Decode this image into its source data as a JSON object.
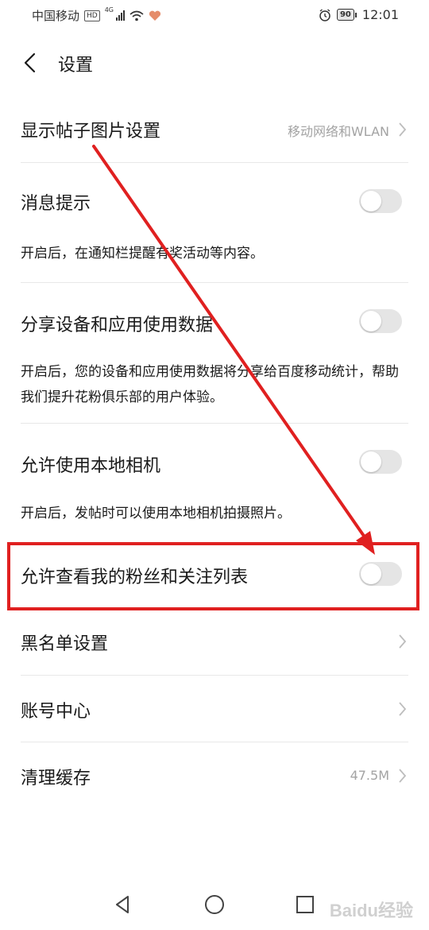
{
  "status_bar": {
    "carrier": "中国移动",
    "hd": "HD",
    "network": "4G",
    "battery": "90",
    "time": "12:01"
  },
  "header": {
    "title": "设置"
  },
  "rows": {
    "image_setting": {
      "label": "显示帖子图片设置",
      "value": "移动网络和WLAN"
    },
    "notification": {
      "label": "消息提示",
      "desc": "开启后，在通知栏提醒有奖活动等内容。",
      "enabled": false
    },
    "share_data": {
      "label": "分享设备和应用使用数据",
      "desc": "开启后，您的设备和应用使用数据将分享给百度移动统计，帮助我们提升花粉俱乐部的用户体验。",
      "enabled": false
    },
    "local_camera": {
      "label": "允许使用本地相机",
      "desc": "开启后，发帖时可以使用本地相机拍摄照片。",
      "enabled": false
    },
    "fans_list": {
      "label": "允许查看我的粉丝和关注列表",
      "enabled": false
    },
    "blacklist": {
      "label": "黑名单设置"
    },
    "account": {
      "label": "账号中心"
    },
    "cache": {
      "label": "清理缓存",
      "value": "47.5M"
    }
  },
  "colors": {
    "annotation_red": "#e02020",
    "switch_off": "#e5e5e5",
    "secondary_text": "#a3a3a3"
  },
  "icons": [
    "back-arrow-icon",
    "chevron-right-icon",
    "alarm-icon",
    "wifi-icon",
    "signal-icon",
    "heart-icon",
    "nav-back-icon",
    "nav-home-icon",
    "nav-recents-icon"
  ],
  "watermark": "Baidu经验"
}
